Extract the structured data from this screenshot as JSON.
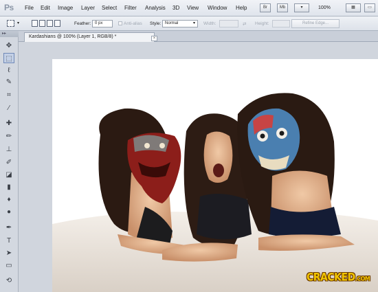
{
  "app": {
    "logo": "Ps"
  },
  "menu": [
    "File",
    "Edit",
    "Image",
    "Layer",
    "Select",
    "Filter",
    "Analysis",
    "3D",
    "View",
    "Window",
    "Help"
  ],
  "top_buttons": {
    "br": "Br",
    "mb": "Mb",
    "zoom": "100%"
  },
  "options": {
    "feather_label": "Feather:",
    "feather_value": "0 px",
    "antialias_label": "Anti-alias",
    "style_label": "Style:",
    "style_value": "Normal",
    "width_label": "Width:",
    "height_label": "Height:",
    "refine_label": "Refine Edge..."
  },
  "document": {
    "tab_title": "Kardashians @ 100% (Layer 1, RGB/8) *",
    "close": "×"
  },
  "watermark": {
    "text": "CRACKED",
    "suffix": ".COM"
  },
  "colors": {
    "accent": "#6f88b6",
    "watermark": "#f2c500"
  }
}
